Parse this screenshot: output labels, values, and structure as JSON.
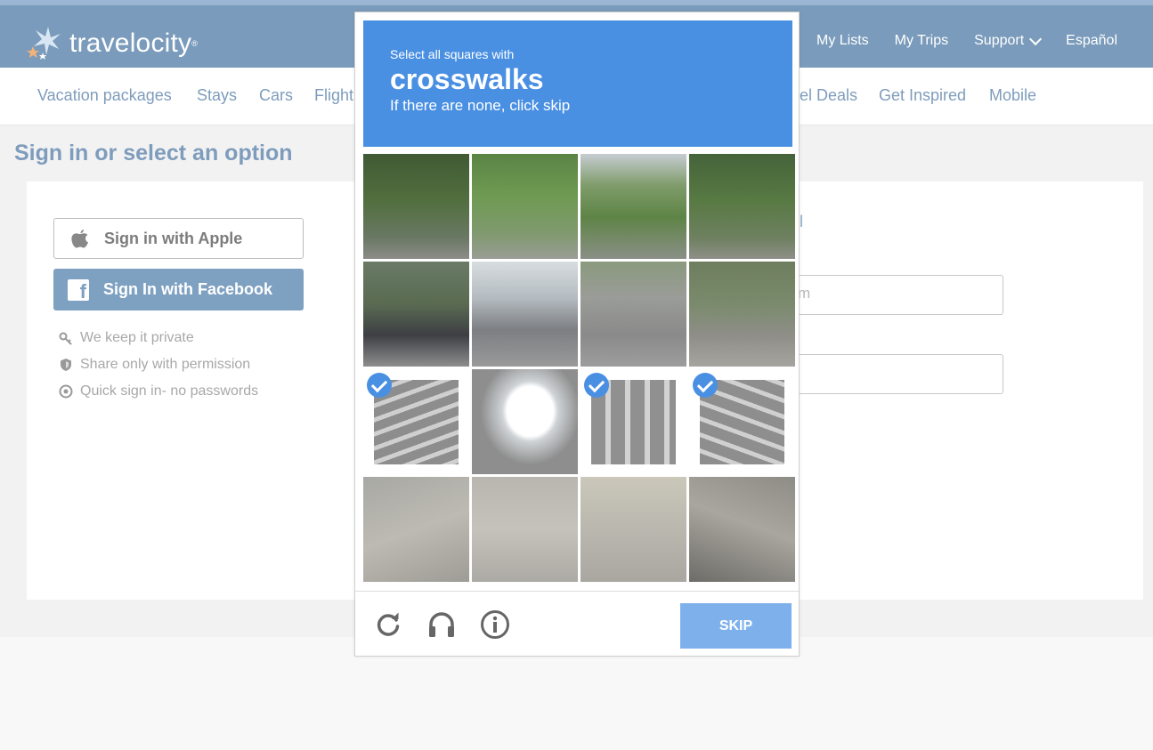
{
  "brand": {
    "name": "travelocity",
    "reg_mark": "®"
  },
  "top_nav": {
    "items": [
      "My Lists",
      "My Trips",
      "Support",
      "Español"
    ]
  },
  "sub_nav": {
    "items": [
      "Vacation packages",
      "Stays",
      "Cars",
      "Flight",
      "el Deals",
      "Get Inspired",
      "Mobile"
    ]
  },
  "signin": {
    "title": "Sign in or select an option",
    "apple_label": "Sign in with Apple",
    "facebook_label": "Sign In with Facebook",
    "perks": [
      "We keep it private",
      "Share only with permission",
      "Quick sign in- no passwords"
    ],
    "email_label_fragment": "ail",
    "email_value_fragment": "m"
  },
  "captcha": {
    "instruction": "Select all squares with",
    "keyword": "crosswalks",
    "hint": "If there are none, click skip",
    "selected_tiles": [
      8,
      10,
      11
    ],
    "skip_label": "SKIP",
    "icons": [
      "reload-icon",
      "audio-icon",
      "info-icon"
    ],
    "colors": {
      "header": "#4a90e2",
      "skip": "#7eb1ec"
    }
  },
  "colors": {
    "topbar": "#7a9bbb",
    "link": "#7e9cbc",
    "facebook": "#7ea0c1"
  }
}
